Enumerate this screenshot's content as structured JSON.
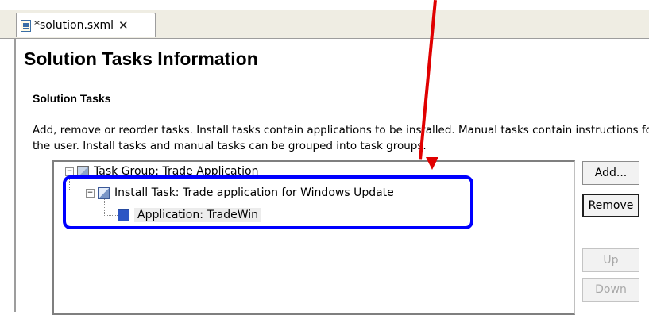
{
  "editor_tab": {
    "label": "*solution.sxml",
    "file_icon": "sxml-file-icon",
    "close_glyph": "✕"
  },
  "page": {
    "title": "Solution Tasks Information",
    "section_title": "Solution Tasks",
    "description": "Add, remove or reorder tasks. Install tasks contain applications to be installed. Manual tasks contain instructions for the user. Install tasks and manual tasks can be grouped into task groups."
  },
  "tree": {
    "nodes": [
      {
        "label": "Task Group: Trade Application",
        "expander": "−",
        "icon": "task-group-icon"
      },
      {
        "label": "Install Task: Trade application for Windows Update",
        "expander": "−",
        "icon": "install-task-icon"
      },
      {
        "label": "Application: TradeWin",
        "icon": "application-icon",
        "selected": true
      }
    ]
  },
  "buttons": {
    "add": "Add...",
    "remove": "Remove",
    "up": "Up",
    "down": "Down"
  },
  "colors": {
    "annotation_box": "#0000ff",
    "annotation_arrow": "#e00000",
    "tabbar_bg": "#efede3"
  }
}
